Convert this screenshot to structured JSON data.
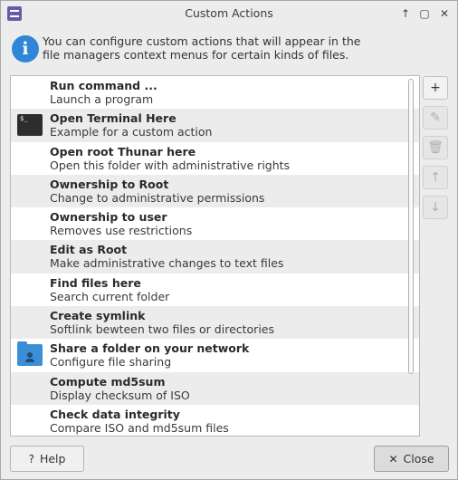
{
  "window": {
    "title": "Custom Actions"
  },
  "titlebar": {
    "up_glyph": "↑",
    "maximize_glyph": "▢",
    "close_glyph": "✕"
  },
  "info": {
    "icon_glyph": "i",
    "line1": "You can configure custom actions that will appear in the",
    "line2": "file managers context menus for certain kinds of files."
  },
  "actions": [
    {
      "name": "Run command ...",
      "description": "Launch a program",
      "icon": "none"
    },
    {
      "name": "Open Terminal Here",
      "description": "Example for a custom action",
      "icon": "terminal-icon",
      "icon_text": "$_"
    },
    {
      "name": "Open root Thunar here",
      "description": "Open this folder with administrative rights",
      "icon": "none"
    },
    {
      "name": "Ownership to Root",
      "description": "Change to administrative permissions",
      "icon": "none"
    },
    {
      "name": "Ownership to user",
      "description": "Removes use restrictions",
      "icon": "none"
    },
    {
      "name": "Edit as Root",
      "description": "Make administrative changes to text files",
      "icon": "none"
    },
    {
      "name": "Find files here",
      "description": "Search current folder",
      "icon": "none"
    },
    {
      "name": "Create symlink",
      "description": "Softlink bewteen two files or directories",
      "icon": "none"
    },
    {
      "name": "Share a folder on your network",
      "description": "Configure file sharing",
      "icon": "folder-share-icon"
    },
    {
      "name": "Compute md5sum",
      "description": "Display checksum of ISO",
      "icon": "none"
    },
    {
      "name": "Check data integrity",
      "description": "Compare ISO and md5sum files",
      "icon": "none"
    }
  ],
  "side_buttons": {
    "add": "+",
    "edit": "✎",
    "delete": "🗑",
    "up": "↑",
    "down": "↓"
  },
  "footer": {
    "help_icon": "?",
    "help_label": "Help",
    "close_icon": "✕",
    "close_label": "Close"
  }
}
